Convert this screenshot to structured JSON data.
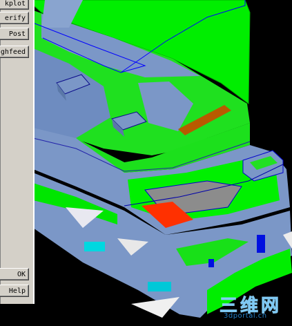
{
  "side_panel": {
    "buttons": [
      {
        "id": "checkplot",
        "label": "kplot"
      },
      {
        "id": "verify",
        "label": "erify"
      },
      {
        "id": "post",
        "label": "Post"
      },
      {
        "id": "highfeed",
        "label": "ghfeed"
      },
      {
        "id": "ok",
        "label": "OK"
      },
      {
        "id": "help",
        "label": "Help"
      }
    ]
  },
  "viewport": {
    "colors": {
      "background": "#000000",
      "primary_surface": "#00ff00",
      "model_surface": "#7b97c7",
      "selection_outline": "#0000ff",
      "feature_orange": "#b85a00",
      "feature_red": "#ff3000",
      "feature_cyan": "#00d8e0"
    }
  },
  "watermark": {
    "logo_text": "三维网",
    "url_text": "3dportal.cn"
  }
}
